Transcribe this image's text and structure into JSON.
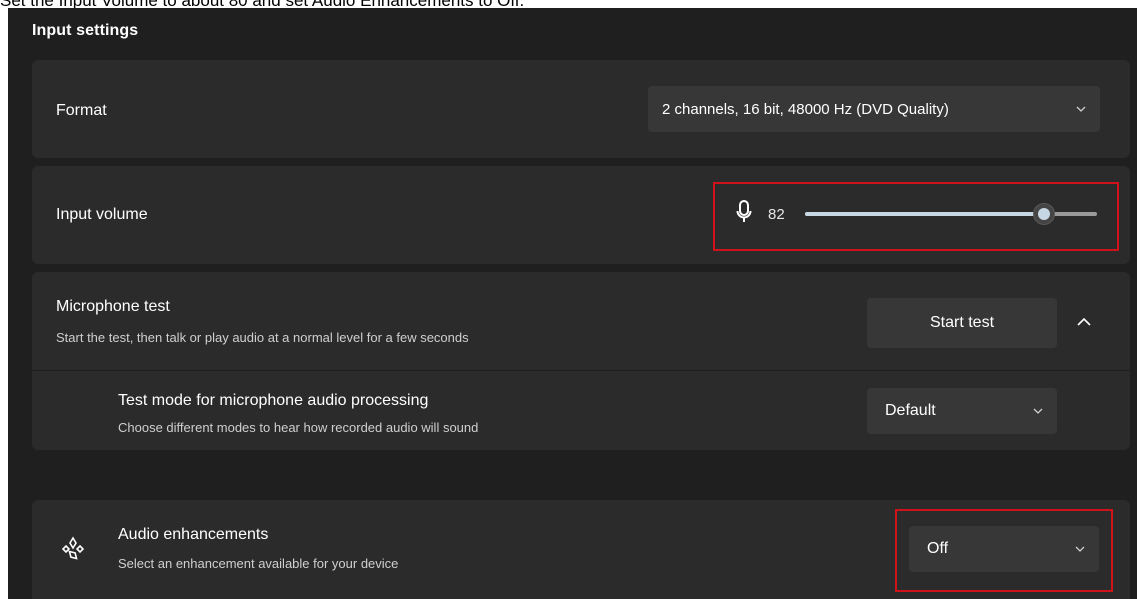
{
  "instruction": "Set the Input Volume to about 80 and set Audio Enhancements to Off.",
  "section_title": "Input settings",
  "format": {
    "label": "Format",
    "value": "2 channels, 16 bit, 48000 Hz (DVD Quality)"
  },
  "input_volume": {
    "label": "Input volume",
    "value_text": "82",
    "level_percent": 82
  },
  "mic_test": {
    "title": "Microphone test",
    "subtitle": "Start the test, then talk or play audio at a normal level for a few seconds",
    "button_label": "Start test"
  },
  "test_mode": {
    "title": "Test mode for microphone audio processing",
    "subtitle": "Choose different modes to hear how recorded audio will sound",
    "value": "Default"
  },
  "audio_enhancements": {
    "title": "Audio enhancements",
    "subtitle": "Select an enhancement available for your device",
    "value": "Off"
  },
  "colors": {
    "panel_bg": "#1f1f1f",
    "card_bg": "#2b2b2b",
    "control_bg": "#373737",
    "accent": "#c8d7e4",
    "highlight": "#d0121b"
  }
}
